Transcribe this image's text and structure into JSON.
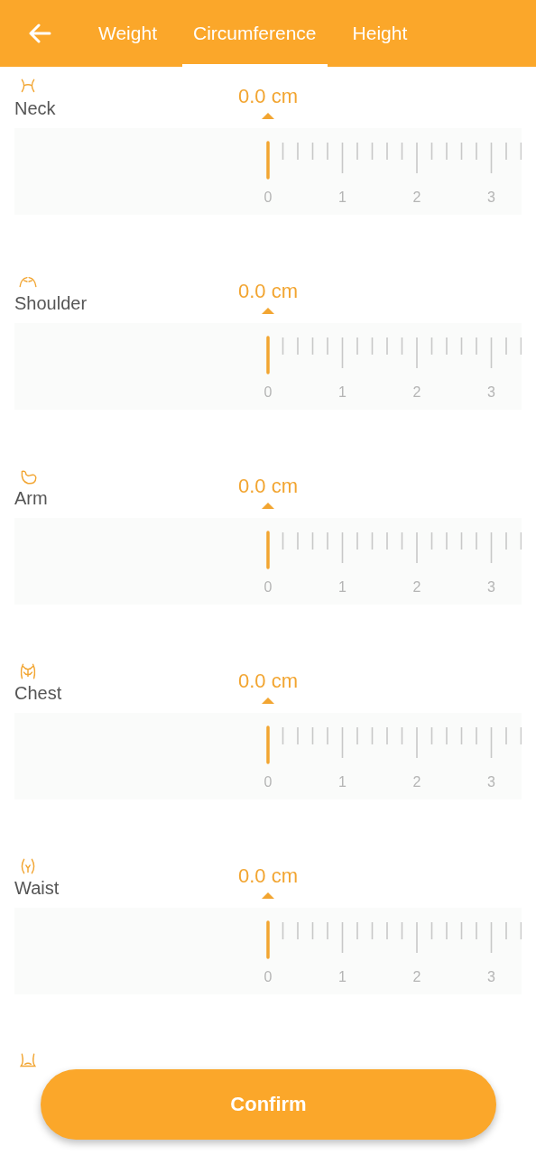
{
  "tabs": [
    {
      "label": "Weight",
      "selected": false
    },
    {
      "label": "Circumference",
      "selected": true
    },
    {
      "label": "Height",
      "selected": false
    }
  ],
  "measurements": [
    {
      "kind": "neck",
      "name": "Neck",
      "value": "0.0 cm",
      "ticks": [
        "0",
        "1",
        "2",
        "3"
      ]
    },
    {
      "kind": "shoulder",
      "name": "Shoulder",
      "value": "0.0 cm",
      "ticks": [
        "0",
        "1",
        "2",
        "3"
      ]
    },
    {
      "kind": "arm",
      "name": "Arm",
      "value": "0.0 cm",
      "ticks": [
        "0",
        "1",
        "2",
        "3"
      ]
    },
    {
      "kind": "chest",
      "name": "Chest",
      "value": "0.0 cm",
      "ticks": [
        "0",
        "1",
        "2",
        "3"
      ]
    },
    {
      "kind": "waist",
      "name": "Waist",
      "value": "0.0 cm",
      "ticks": [
        "0",
        "1",
        "2",
        "3"
      ]
    },
    {
      "kind": "hip"
    }
  ],
  "confirm_button": "Confirm"
}
